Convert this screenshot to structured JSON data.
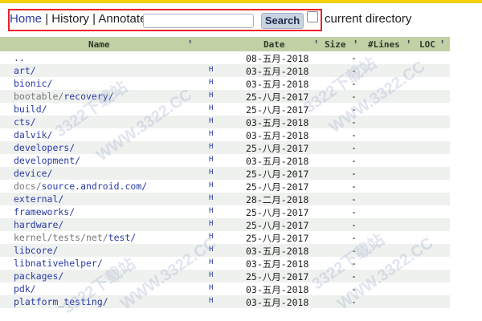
{
  "toolbar": {
    "home": "Home",
    "sep1": "|",
    "history": "History",
    "sep2": "|",
    "annotate": "Annotate",
    "search_value": "",
    "search_button": "Search",
    "current_dir_label": "current directory"
  },
  "table": {
    "headers": {
      "name": "Name",
      "date": "Date",
      "size": "Size",
      "lines": "#Lines",
      "loc": "LOC"
    },
    "rows": [
      {
        "prefix": "",
        "name": "..",
        "history": "",
        "date": "08-五月-2018",
        "size": "-"
      },
      {
        "prefix": "",
        "name": "art/",
        "history": "H",
        "date": "03-五月-2018",
        "size": "-"
      },
      {
        "prefix": "",
        "name": "bionic/",
        "history": "H",
        "date": "03-五月-2018",
        "size": "-"
      },
      {
        "prefix": "bootable/",
        "name": "recovery/",
        "history": "H",
        "date": "25-八月-2017",
        "size": "-"
      },
      {
        "prefix": "",
        "name": "build/",
        "history": "H",
        "date": "25-八月-2017",
        "size": "-"
      },
      {
        "prefix": "",
        "name": "cts/",
        "history": "H",
        "date": "03-五月-2018",
        "size": "-"
      },
      {
        "prefix": "",
        "name": "dalvik/",
        "history": "H",
        "date": "03-五月-2018",
        "size": "-"
      },
      {
        "prefix": "",
        "name": "developers/",
        "history": "H",
        "date": "25-八月-2017",
        "size": "-"
      },
      {
        "prefix": "",
        "name": "development/",
        "history": "H",
        "date": "03-五月-2018",
        "size": "-"
      },
      {
        "prefix": "",
        "name": "device/",
        "history": "H",
        "date": "25-八月-2017",
        "size": "-"
      },
      {
        "prefix": "docs/",
        "name": "source.android.com/",
        "history": "H",
        "date": "25-八月-2017",
        "size": "-"
      },
      {
        "prefix": "",
        "name": "external/",
        "history": "H",
        "date": "28-二月-2018",
        "size": "-"
      },
      {
        "prefix": "",
        "name": "frameworks/",
        "history": "H",
        "date": "25-八月-2017",
        "size": "-"
      },
      {
        "prefix": "",
        "name": "hardware/",
        "history": "H",
        "date": "25-八月-2017",
        "size": "-"
      },
      {
        "prefix": "kernel/tests/net/",
        "name": "test/",
        "history": "H",
        "date": "25-八月-2017",
        "size": "-"
      },
      {
        "prefix": "",
        "name": "libcore/",
        "history": "H",
        "date": "03-五月-2018",
        "size": "-"
      },
      {
        "prefix": "",
        "name": "libnativehelper/",
        "history": "H",
        "date": "03-五月-2018",
        "size": "-"
      },
      {
        "prefix": "",
        "name": "packages/",
        "history": "H",
        "date": "25-八月-2017",
        "size": "-"
      },
      {
        "prefix": "",
        "name": "pdk/",
        "history": "H",
        "date": "03-五月-2018",
        "size": "-"
      },
      {
        "prefix": "",
        "name": "platform_testing/",
        "history": "H",
        "date": "03-五月-2018",
        "size": "-"
      }
    ]
  },
  "watermarks": [
    "3322下载站",
    "WWW.3322.CC"
  ],
  "colors": {
    "header_bg": "#c2d0a5",
    "link": "#2a3aa5",
    "highlight_box": "#e8202a",
    "top_stripe": "#f5d10b"
  }
}
